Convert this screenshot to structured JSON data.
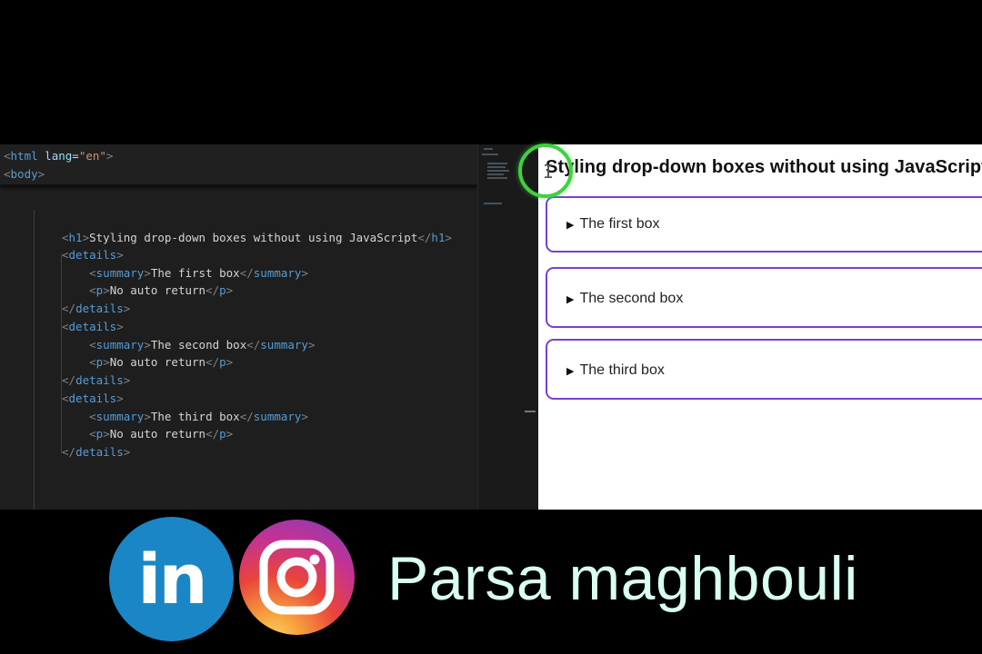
{
  "editor": {
    "lines": [
      [
        [
          "tg",
          "<"
        ],
        [
          "tn",
          "html"
        ],
        [
          "tx",
          " "
        ],
        [
          "at",
          "lang"
        ],
        [
          "tx",
          "="
        ],
        [
          "av",
          "\"en\""
        ],
        [
          "tg",
          ">"
        ]
      ],
      [
        [
          "tg",
          "<"
        ],
        [
          "tn",
          "body"
        ],
        [
          "tg",
          ">"
        ]
      ],
      [],
      [],
      [
        [
          "tg",
          "<"
        ],
        [
          "tn",
          "h1"
        ],
        [
          "tg",
          ">"
        ],
        [
          "tx",
          "Styling drop-down boxes without using JavaScript"
        ],
        [
          "tg",
          "</"
        ],
        [
          "tn",
          "h1"
        ],
        [
          "tg",
          ">"
        ]
      ],
      [
        [
          "tg",
          "<"
        ],
        [
          "tn",
          "details"
        ],
        [
          "tg",
          ">"
        ]
      ],
      [
        [
          "tx",
          "    "
        ],
        [
          "tg",
          "<"
        ],
        [
          "tn",
          "summary"
        ],
        [
          "tg",
          ">"
        ],
        [
          "tx",
          "The first box"
        ],
        [
          "tg",
          "</"
        ],
        [
          "tn",
          "summary"
        ],
        [
          "tg",
          ">"
        ]
      ],
      [
        [
          "tx",
          "    "
        ],
        [
          "tg",
          "<"
        ],
        [
          "tn",
          "p"
        ],
        [
          "tg",
          ">"
        ],
        [
          "tx",
          "No auto return"
        ],
        [
          "tg",
          "</"
        ],
        [
          "tn",
          "p"
        ],
        [
          "tg",
          ">"
        ]
      ],
      [
        [
          "tg",
          "</"
        ],
        [
          "tn",
          "details"
        ],
        [
          "tg",
          ">"
        ]
      ],
      [
        [
          "tg",
          "<"
        ],
        [
          "tn",
          "details"
        ],
        [
          "tg",
          ">"
        ]
      ],
      [
        [
          "tx",
          "    "
        ],
        [
          "tg",
          "<"
        ],
        [
          "tn",
          "summary"
        ],
        [
          "tg",
          ">"
        ],
        [
          "tx",
          "The second box"
        ],
        [
          "tg",
          "</"
        ],
        [
          "tn",
          "summary"
        ],
        [
          "tg",
          ">"
        ]
      ],
      [
        [
          "tx",
          "    "
        ],
        [
          "tg",
          "<"
        ],
        [
          "tn",
          "p"
        ],
        [
          "tg",
          ">"
        ],
        [
          "tx",
          "No auto return"
        ],
        [
          "tg",
          "</"
        ],
        [
          "tn",
          "p"
        ],
        [
          "tg",
          ">"
        ]
      ],
      [
        [
          "tg",
          "</"
        ],
        [
          "tn",
          "details"
        ],
        [
          "tg",
          ">"
        ]
      ],
      [
        [
          "tg",
          "<"
        ],
        [
          "tn",
          "details"
        ],
        [
          "tg",
          ">"
        ]
      ],
      [
        [
          "tx",
          "    "
        ],
        [
          "tg",
          "<"
        ],
        [
          "tn",
          "summary"
        ],
        [
          "tg",
          ">"
        ],
        [
          "tx",
          "The third box"
        ],
        [
          "tg",
          "</"
        ],
        [
          "tn",
          "summary"
        ],
        [
          "tg",
          ">"
        ]
      ],
      [
        [
          "tx",
          "    "
        ],
        [
          "tg",
          "<"
        ],
        [
          "tn",
          "p"
        ],
        [
          "tg",
          ">"
        ],
        [
          "tx",
          "No auto return"
        ],
        [
          "tg",
          "</"
        ],
        [
          "tn",
          "p"
        ],
        [
          "tg",
          ">"
        ]
      ],
      [
        [
          "tg",
          "</"
        ],
        [
          "tn",
          "details"
        ],
        [
          "tg",
          ">"
        ]
      ]
    ]
  },
  "browser": {
    "title": "Styling drop-down boxes without using JavaScript",
    "boxes": [
      {
        "summary": "The first box"
      },
      {
        "summary": "The second box"
      },
      {
        "summary": "The third box"
      }
    ],
    "marker": "▶"
  },
  "banner": {
    "linkedin_text": "in",
    "username": "Parsa maghbouli"
  },
  "colors": {
    "box_border": "#7b3fd1",
    "cursor_highlight": "#3fd13f",
    "linkedin": "#1b86c6",
    "username": "#d8fff2"
  },
  "icons": [
    "linkedin-icon",
    "instagram-icon",
    "disclosure-triangle-icon",
    "text-cursor-icon"
  ]
}
